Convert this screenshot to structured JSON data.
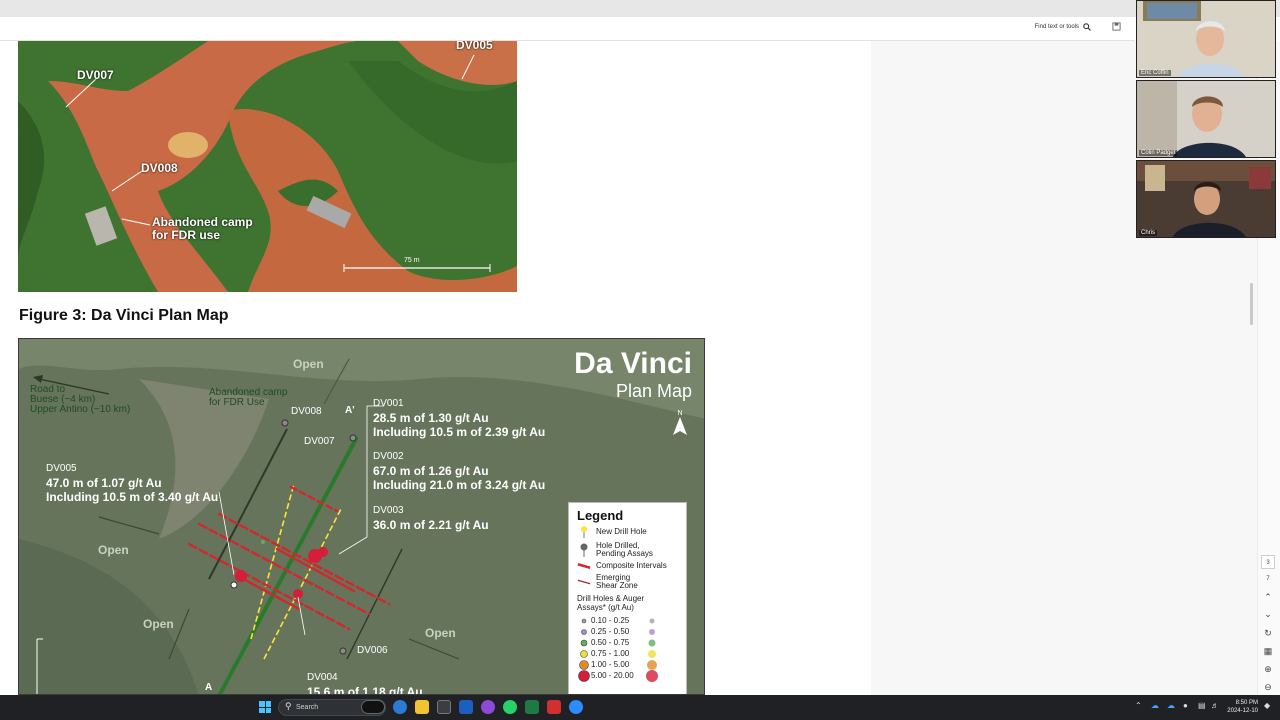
{
  "toolbar": {
    "find_label": "Find text or tools"
  },
  "aerial_photo": {
    "labels": [
      "DV005",
      "DV007",
      "DV008"
    ],
    "camp_label_line1": "Abandoned camp",
    "camp_label_line2": "for FDR use",
    "scale_label": "75 m"
  },
  "figure_title": "Figure 3: Da Vinci Plan Map",
  "map": {
    "title": "Da Vinci",
    "subtitle": "Plan Map",
    "north": "N",
    "open_labels": [
      "Open",
      "Open",
      "Open",
      "Open"
    ],
    "road_line1": "Road to",
    "road_line2": "Buese (~4 km)",
    "road_line3": "Upper Antino (~10 km)",
    "camp_line1": "Abandoned camp",
    "camp_line2": "for FDR Use",
    "holes": {
      "dv008": "DV008",
      "dv007": "DV007",
      "dv006": "DV006",
      "a_prime": "A'",
      "a": "A"
    },
    "results": {
      "dv001": {
        "name": "DV001",
        "line1": "28.5 m of 1.30 g/t Au",
        "line2": "Including 10.5 m of 2.39 g/t Au"
      },
      "dv002": {
        "name": "DV002",
        "line1": "67.0 m of 1.26 g/t Au",
        "line2": "Including 21.0 m of 3.24 g/t Au"
      },
      "dv003": {
        "name": "DV003",
        "line1": "36.0 m of 2.21 g/t Au"
      },
      "dv005": {
        "name": "DV005",
        "line1": "47.0 m of 1.07 g/t Au",
        "line2": "Including 10.5 m of 3.40 g/t Au"
      },
      "dv004": {
        "name": "DV004",
        "line1": "15.6 m of 1.18 g/t Au"
      }
    },
    "legend": {
      "title": "Legend",
      "new_hole": "New Drill Hole",
      "pending_line1": "Hole Drilled,",
      "pending_line2": "Pending Assays",
      "composite": "Composite Intervals",
      "shear_line1": "Emerging",
      "shear_line2": "Shear Zone",
      "assay_line1": "Drill Holes & Auger",
      "assay_line2": "Assays* (g/t Au)",
      "ranges": [
        "0.10 - 0.25",
        "0.25 - 0.50",
        "0.50 - 0.75",
        "0.75 - 1.00",
        "1.00 - 5.00",
        "5.00 - 20.00"
      ],
      "colors": [
        "#9aa2a8",
        "#a88bd2",
        "#5fae62",
        "#e6e234",
        "#e08a2a",
        "#d41e3a"
      ]
    }
  },
  "participants": [
    {
      "name": "Eric Coffin"
    },
    {
      "name": "Colin Padget"
    },
    {
      "name": "Chris"
    }
  ],
  "right_rail": {
    "page_num": "3",
    "page_total": "7"
  },
  "taskbar": {
    "search_placeholder": "Search",
    "time": "8:50 PM",
    "date": "2024-12-10"
  }
}
